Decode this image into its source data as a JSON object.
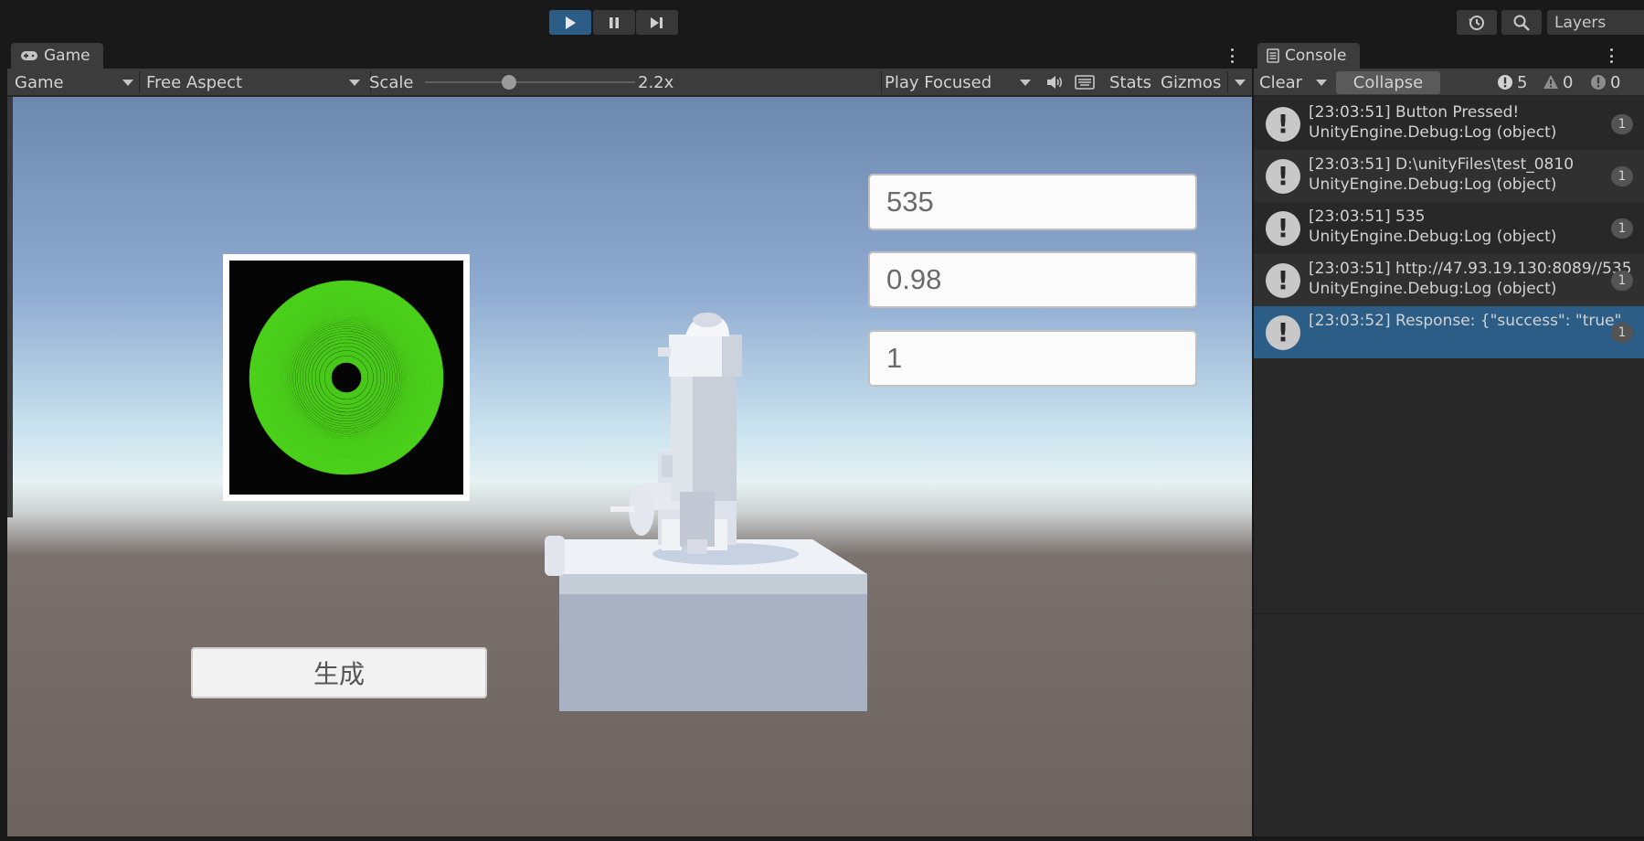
{
  "toolbar": {
    "layers_label": "Layers",
    "play_icon": "play-icon",
    "pause_icon": "pause-icon",
    "step_icon": "step-icon",
    "history_icon": "history-icon",
    "search_icon": "search-icon"
  },
  "game": {
    "tab_label": "Game",
    "display_dropdown": "Game",
    "aspect_dropdown": "Free Aspect",
    "scale_label": "Scale",
    "scale_value": "2.2x",
    "scale_slider_fraction": 0.4,
    "play_mode_dropdown": "Play Focused",
    "stats_label": "Stats",
    "gizmos_label": "Gizmos",
    "inputs": [
      {
        "value": "535"
      },
      {
        "value": "0.98"
      },
      {
        "value": "1"
      }
    ],
    "generate_button_label": "生成",
    "colors": {
      "ring_green": "#4cd41a",
      "ring_dark": "#050505"
    }
  },
  "console": {
    "tab_label": "Console",
    "clear_label": "Clear",
    "collapse_label": "Collapse",
    "info_count": "5",
    "warning_count": "0",
    "error_count": "0",
    "logs": [
      {
        "line1": "[23:03:51] Button Pressed!",
        "line2": "UnityEngine.Debug:Log (object)",
        "count": "1"
      },
      {
        "line1": "[23:03:51] D:\\unityFiles\\test_0810",
        "line2": "UnityEngine.Debug:Log (object)",
        "count": "1"
      },
      {
        "line1": "[23:03:51] 535",
        "line2": "UnityEngine.Debug:Log (object)",
        "count": "1"
      },
      {
        "line1": "[23:03:51] http://47.93.19.130:8089//535",
        "line2": "UnityEngine.Debug:Log (object)",
        "count": "1"
      },
      {
        "line1": "[23:03:52] Response: {\"success\": \"true\",",
        "line2": "",
        "count": "1"
      }
    ]
  }
}
